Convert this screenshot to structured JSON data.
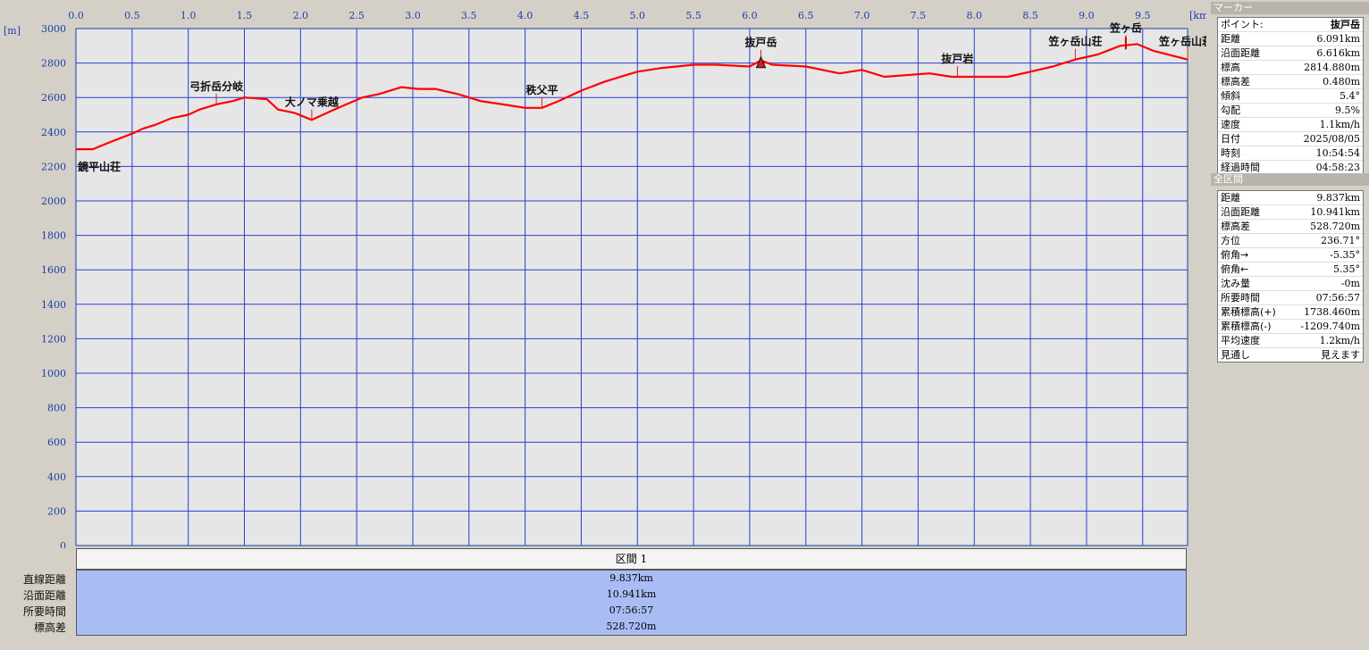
{
  "chart_data": {
    "type": "line",
    "xlabel": "[km]",
    "ylabel": "[m]",
    "xlim": [
      0,
      9.9
    ],
    "ylim": [
      0,
      3000
    ],
    "x_ticks": [
      "0.0",
      "0.5",
      "1.0",
      "1.5",
      "2.0",
      "2.5",
      "3.0",
      "3.5",
      "4.0",
      "4.5",
      "5.0",
      "5.5",
      "6.0",
      "6.5",
      "7.0",
      "7.5",
      "8.0",
      "8.5",
      "9.0",
      "9.5"
    ],
    "y_ticks": [
      "3000",
      "2800",
      "2600",
      "2400",
      "2200",
      "2000",
      "1800",
      "1600",
      "1400",
      "1200",
      "1000",
      "800",
      "600",
      "400",
      "200",
      "0"
    ],
    "grid": true,
    "series": [
      {
        "color": "#ff0000",
        "x": [
          0,
          0.15,
          0.3,
          0.5,
          0.6,
          0.7,
          0.85,
          1.0,
          1.1,
          1.25,
          1.4,
          1.5,
          1.7,
          1.8,
          1.95,
          2.1,
          2.3,
          2.55,
          2.7,
          2.9,
          3.05,
          3.2,
          3.4,
          3.6,
          3.8,
          4.0,
          4.15,
          4.3,
          4.5,
          4.7,
          4.9,
          5.0,
          5.2,
          5.5,
          5.7,
          6.0,
          6.1,
          6.2,
          6.5,
          6.8,
          7.0,
          7.2,
          7.6,
          7.8,
          8.0,
          8.3,
          8.5,
          8.7,
          8.9,
          9.1,
          9.3,
          9.45,
          9.6,
          9.9
        ],
        "values": [
          2300,
          2300,
          2340,
          2390,
          2420,
          2440,
          2480,
          2500,
          2530,
          2560,
          2580,
          2600,
          2590,
          2530,
          2510,
          2470,
          2530,
          2600,
          2620,
          2660,
          2650,
          2650,
          2620,
          2580,
          2560,
          2540,
          2540,
          2580,
          2640,
          2690,
          2730,
          2750,
          2770,
          2790,
          2790,
          2780,
          2815,
          2790,
          2780,
          2740,
          2760,
          2720,
          2740,
          2720,
          2720,
          2720,
          2750,
          2780,
          2820,
          2850,
          2900,
          2910,
          2870,
          2820
        ]
      }
    ],
    "annotations": [
      {
        "label": "鏡平山荘",
        "x": 0.0,
        "y": 2300
      },
      {
        "label": "弓折岳分岐",
        "x": 1.25,
        "y": 2560
      },
      {
        "label": "大ノマ乗越",
        "x": 2.1,
        "y": 2470
      },
      {
        "label": "秩父平",
        "x": 4.15,
        "y": 2540
      },
      {
        "label": "抜戸岳",
        "x": 6.1,
        "y": 2815
      },
      {
        "label": "抜戸岩",
        "x": 7.85,
        "y": 2720
      },
      {
        "label": "笠ヶ岳山荘",
        "x": 8.9,
        "y": 2820
      },
      {
        "label": "笠ヶ岳",
        "x": 9.35,
        "y": 2900
      },
      {
        "label": "笠ヶ岳山荘",
        "x": 9.9,
        "y": 2820
      }
    ]
  },
  "section": {
    "header": "区間 1",
    "rows": [
      {
        "label": "直線距離",
        "value": "9.837km"
      },
      {
        "label": "沿面距離",
        "value": "10.941km"
      },
      {
        "label": "所要時間",
        "value": "07:56:57"
      },
      {
        "label": "標高差",
        "value": "528.720m"
      }
    ]
  },
  "marker_panel": {
    "title": "マーカー",
    "rows": [
      {
        "key": "ポイント:",
        "value": "抜戸岳"
      },
      {
        "key": "距離",
        "value": "6.091km"
      },
      {
        "key": "沿面距離",
        "value": "6.616km"
      },
      {
        "key": "標高",
        "value": "2814.880m"
      },
      {
        "key": "標高差",
        "value": "0.480m"
      },
      {
        "key": "傾斜",
        "value": "5.4°"
      },
      {
        "key": "勾配",
        "value": "9.5%"
      },
      {
        "key": "速度",
        "value": "1.1km/h"
      },
      {
        "key": "日付",
        "value": "2025/08/05"
      },
      {
        "key": "時刻",
        "value": "10:54:54"
      },
      {
        "key": "経過時間",
        "value": "04:58:23"
      }
    ]
  },
  "total_panel": {
    "title": "全区間",
    "rows": [
      {
        "key": "距離",
        "value": "9.837km"
      },
      {
        "key": "沿面距離",
        "value": "10.941km"
      },
      {
        "key": "標高差",
        "value": "528.720m"
      },
      {
        "key": "方位",
        "value": "236.71°"
      },
      {
        "key": "俯角→",
        "value": "-5.35°"
      },
      {
        "key": "俯角←",
        "value": "5.35°"
      },
      {
        "key": "沈み量",
        "value": "-0m"
      },
      {
        "key": "所要時間",
        "value": "07:56:57"
      },
      {
        "key": "累積標高(+)",
        "value": "1738.460m"
      },
      {
        "key": "累積標高(-)",
        "value": "-1209.740m"
      },
      {
        "key": "平均速度",
        "value": "1.2km/h"
      },
      {
        "key": "見通し",
        "value": "見えます"
      }
    ]
  }
}
